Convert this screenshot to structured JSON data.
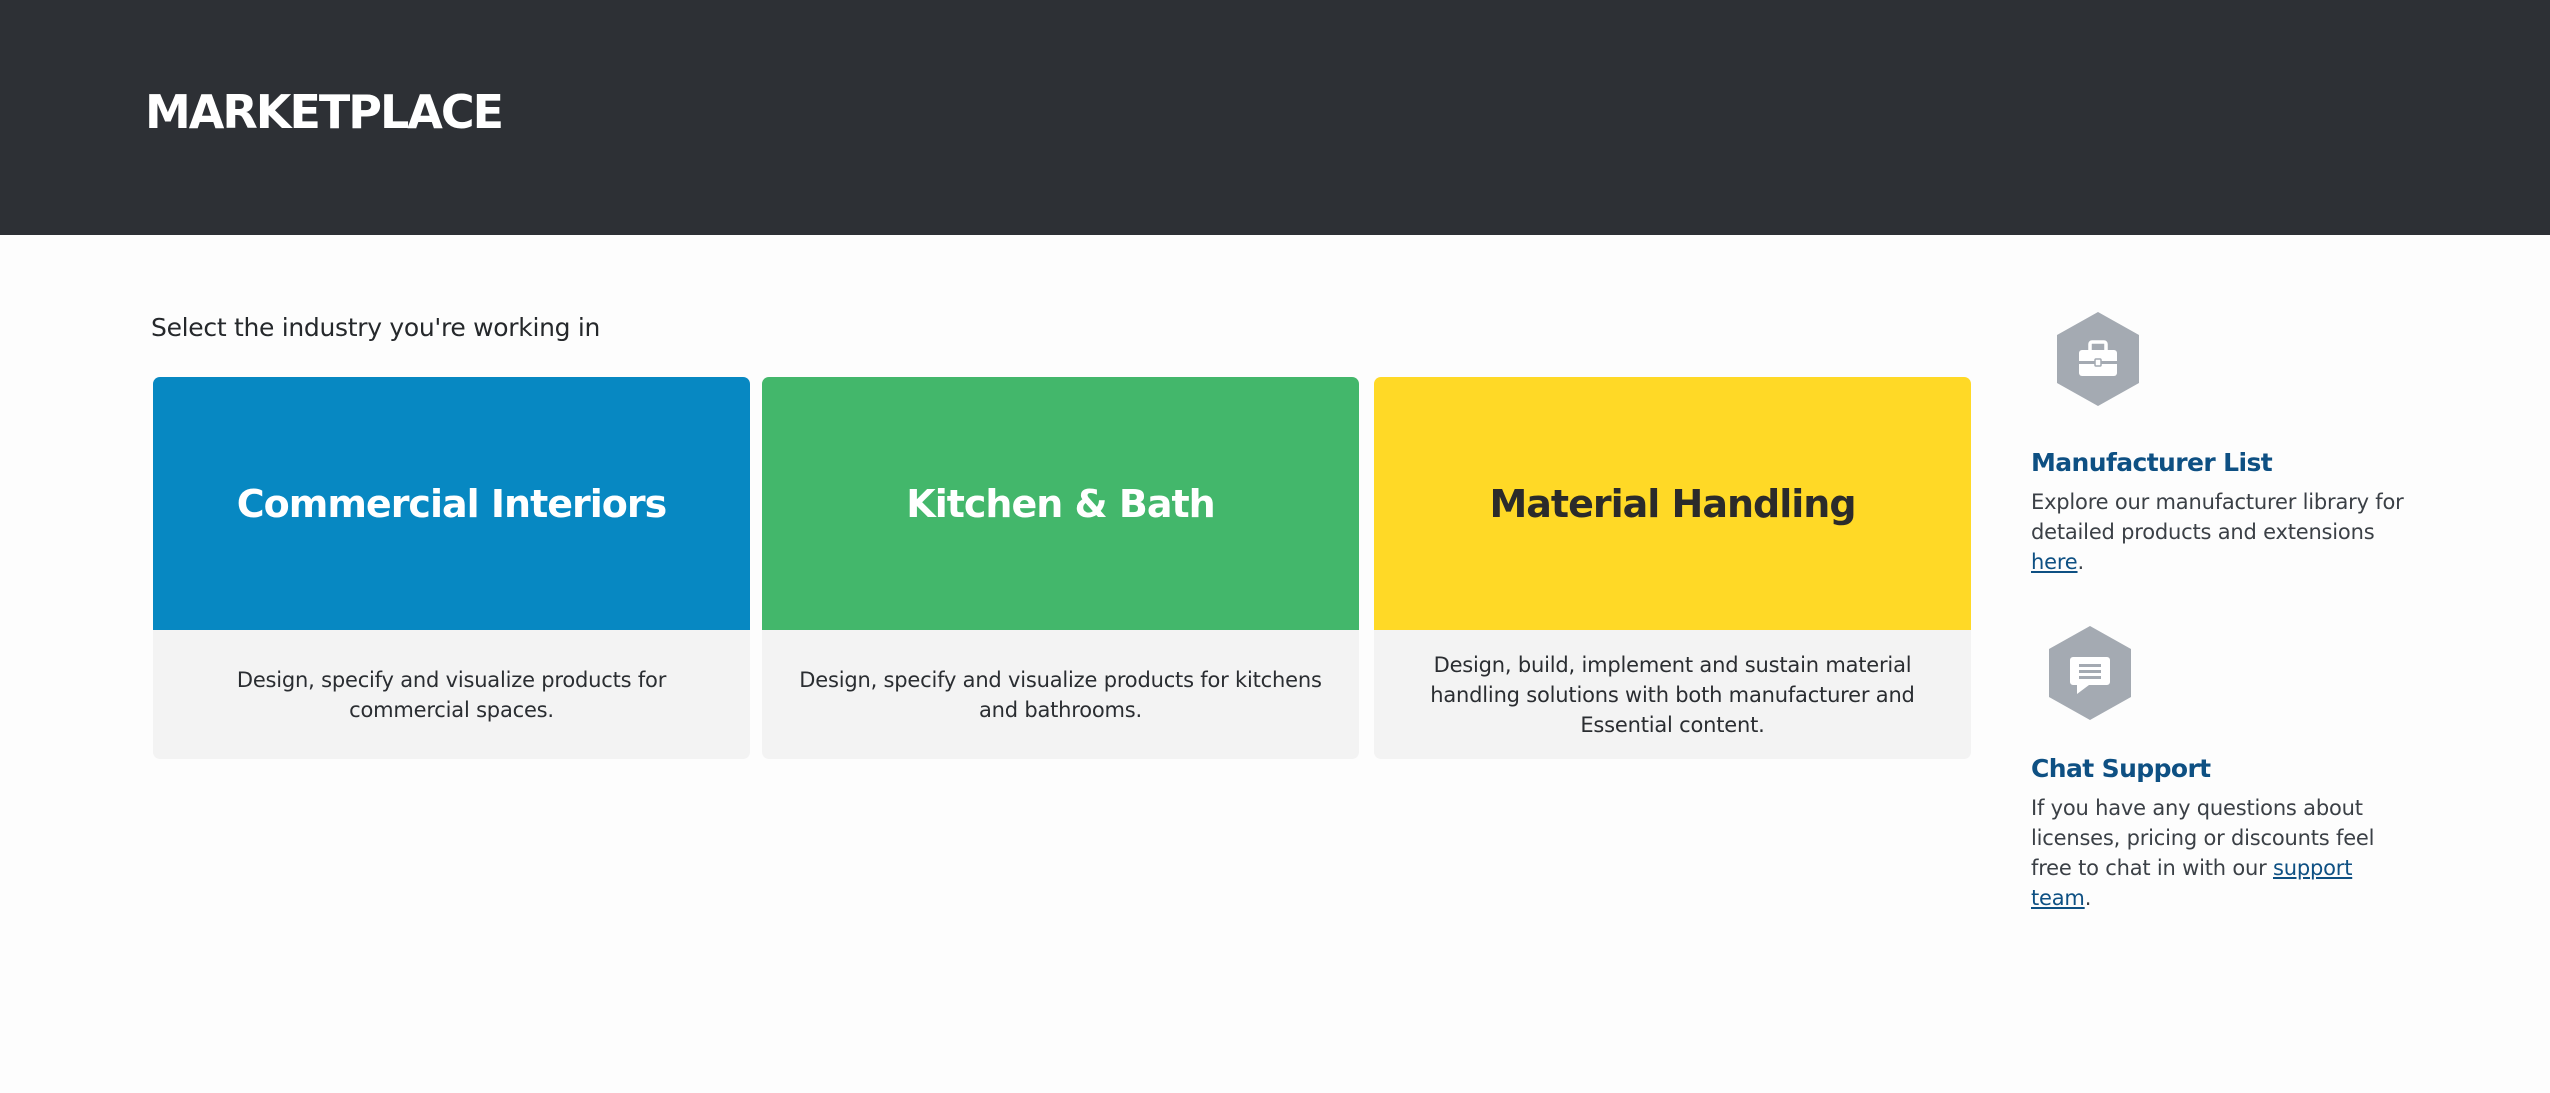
{
  "header": {
    "title": "MARKETPLACE"
  },
  "main": {
    "prompt": "Select the industry you're working in",
    "cards": [
      {
        "title": "Commercial Interiors",
        "description": "Design, specify and visualize products for commercial spaces.",
        "color": "#0788c2",
        "title_color": "#ffffff"
      },
      {
        "title": "Kitchen & Bath",
        "description": "Design, specify and visualize products for kitchens and bathrooms.",
        "color": "#43b76b",
        "title_color": "#ffffff"
      },
      {
        "title": "Material Handling",
        "description": "Design, build, implement and sustain material handling solutions with both manufacturer and Essential content.",
        "color": "#ffd926",
        "title_color": "#2b2b2b"
      }
    ]
  },
  "sidebar": {
    "manufacturer": {
      "icon": "toolbox-icon",
      "heading": "Manufacturer List",
      "text_before": "Explore our manufacturer library for detailed products and extensions ",
      "link": "here",
      "text_after": "."
    },
    "chat": {
      "icon": "chat-icon",
      "heading": "Chat Support",
      "text_before": "If you have any questions about licenses, pricing or discounts feel free to chat in with our ",
      "link": "support team",
      "text_after": "."
    },
    "icon_color": "#a4aab2"
  }
}
